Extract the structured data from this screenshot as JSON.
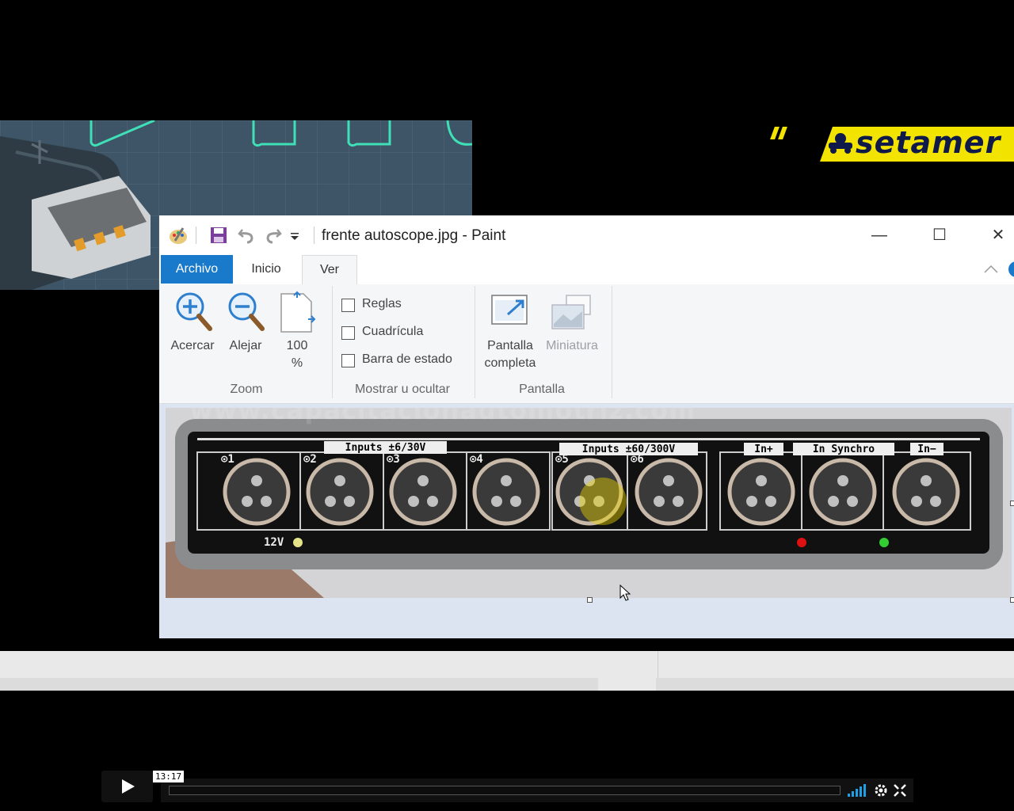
{
  "brand": {
    "name": "setamer"
  },
  "paint": {
    "title": "frente autoscope.jpg - Paint",
    "window_buttons": {
      "minimize": "—",
      "maximize": "☐",
      "close": "✕"
    },
    "tabs": [
      {
        "label": "Archivo"
      },
      {
        "label": "Inicio"
      },
      {
        "label": "Ver"
      }
    ],
    "zoom": {
      "zoom_in_label": "Acercar",
      "zoom_out_label": "Alejar",
      "actual_size_line1": "100",
      "actual_size_line2": "%",
      "group_label": "Zoom"
    },
    "show_hide": {
      "rulers_label": "Reglas",
      "gridlines_label": "Cuadrícula",
      "statusbar_label": "Barra de estado",
      "group_label": "Mostrar u ocultar"
    },
    "display": {
      "fullscreen_line1": "Pantalla",
      "fullscreen_line2": "completa",
      "thumbnail_label": "Miniatura",
      "group_label": "Pantalla"
    }
  },
  "device": {
    "inputs_left": "Inputs  ±6/30V",
    "inputs_mid": "Inputs  ±60/300V",
    "sync": {
      "plus": "In+",
      "center": "In Synchro",
      "minus": "In−"
    },
    "channels": [
      "⊙1",
      "⊙2",
      "⊙3",
      "⊙4",
      "⊙5",
      "⊙6"
    ],
    "power_label": "12V"
  },
  "watermark": "www.capacitacionautomotriz.com",
  "player": {
    "time": "13:17",
    "progress": 0.0
  },
  "colors": {
    "accent": "#1979ca",
    "brand_yellow": "#f2e400",
    "brand_navy": "#0f1a4a"
  }
}
